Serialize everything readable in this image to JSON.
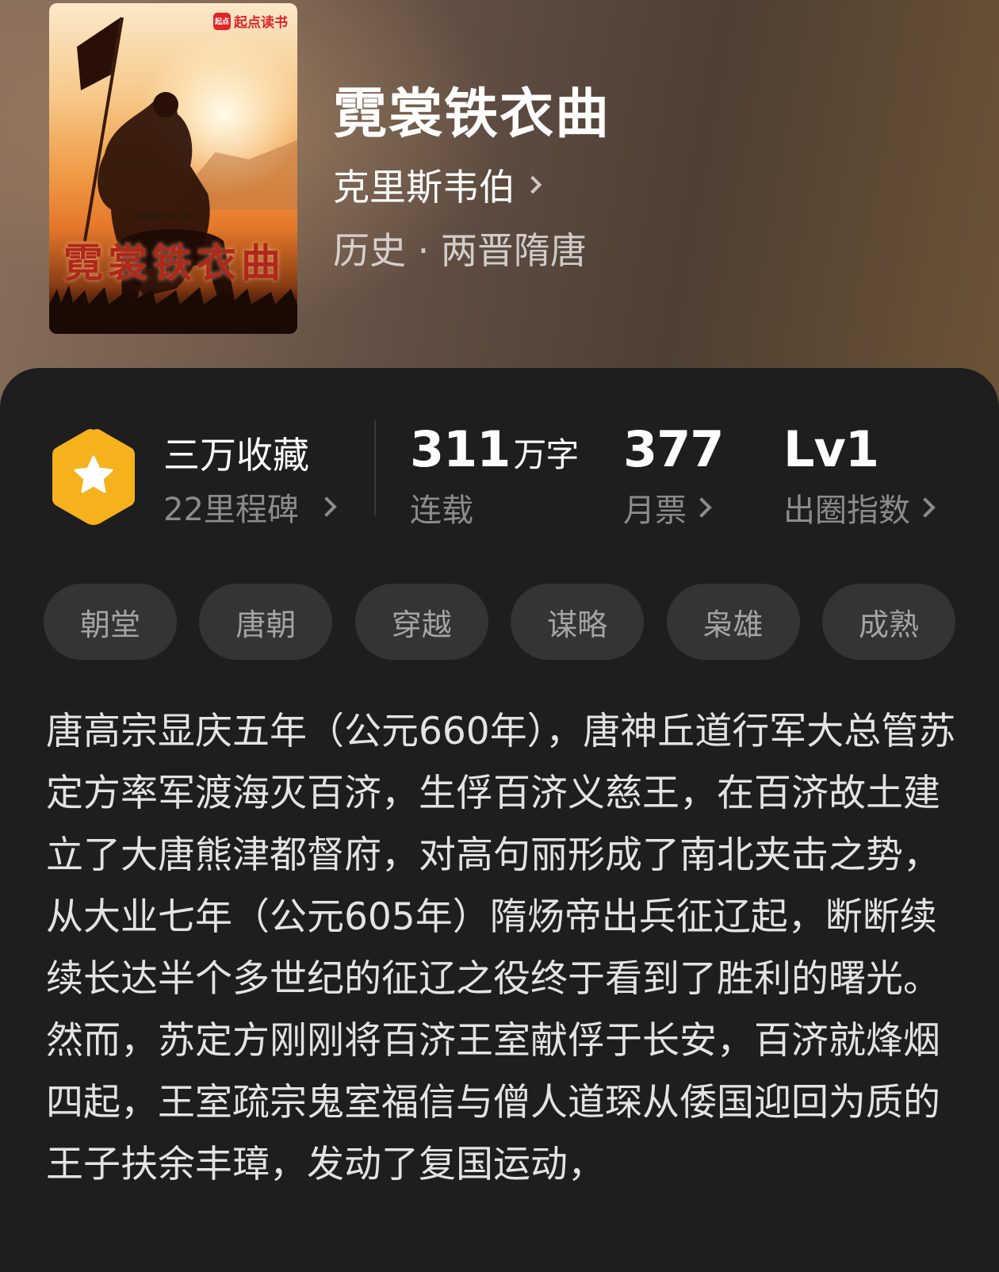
{
  "book": {
    "title": "霓裳铁衣曲",
    "author": "克里斯韦伯",
    "genre": "历史 · 两晋隋唐"
  },
  "cover": {
    "platform_badge": "起点读书",
    "platform_logo": "起点",
    "author_line": "克里斯韦伯 著",
    "title_text": "霓裳铁衣曲"
  },
  "stats": {
    "collection": {
      "label": "三万收藏",
      "milestones": "22里程碑"
    },
    "words": {
      "value": "311",
      "unit": "万字",
      "label": "连载"
    },
    "monthly_votes": {
      "value": "377",
      "label": "月票"
    },
    "popularity": {
      "value": "Lv1",
      "label": "出圈指数"
    }
  },
  "tags": [
    "朝堂",
    "唐朝",
    "穿越",
    "谋略",
    "枭雄",
    "成熟"
  ],
  "description": [
    "唐高宗显庆五年（公元660年），唐神丘道行军大总管苏定方率军渡海灭百济，生俘百济义慈王，在百济故土建立了大唐熊津都督府，对高句丽形成了南北夹击之势，从大业七年（公元605年）隋炀帝出兵征辽起，断断续续长达半个多世纪的征辽之役终于看到了胜利的曙光。",
    "然而，苏定方刚刚将百济王室献俘于长安，百济就烽烟四起，王室疏宗鬼室福信与僧人道琛从倭国迎回为质的王子扶余丰璋，发动了复国运动，"
  ],
  "colors": {
    "panel_bg": "#1e1e1f",
    "tag_bg": "#343435",
    "badge_orange": "#f6b21c",
    "muted_text": "#8b8b8b"
  }
}
